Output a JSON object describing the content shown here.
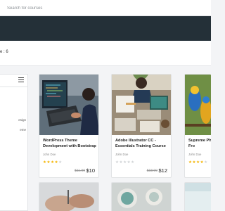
{
  "search": {
    "placeholder": "Search for courses"
  },
  "results": {
    "count_text": "e : 6"
  },
  "sidebar": {
    "items": [
      {
        "label": "esign"
      },
      {
        "label": "eme"
      }
    ]
  },
  "courses": [
    {
      "title": "WordPress Theme Development with Bootstrap",
      "author": "John Doe",
      "rating": 4,
      "old_price": "$11.99",
      "price": "$10",
      "image": "code-laptop"
    },
    {
      "title": "Adobe Illustrator CC - Essentials Training Course",
      "author": "John Doe",
      "rating": 0,
      "old_price": "$18.99",
      "price": "$12",
      "image": "design-desk"
    },
    {
      "title": "Supreme Ph Training: Fro",
      "author": "John Doe",
      "rating": 4,
      "old_price": "",
      "price": "",
      "image": "parrots"
    }
  ],
  "colors": {
    "header": "#243038",
    "star": "#f4b400",
    "page_bg": "#f3f4f6"
  }
}
